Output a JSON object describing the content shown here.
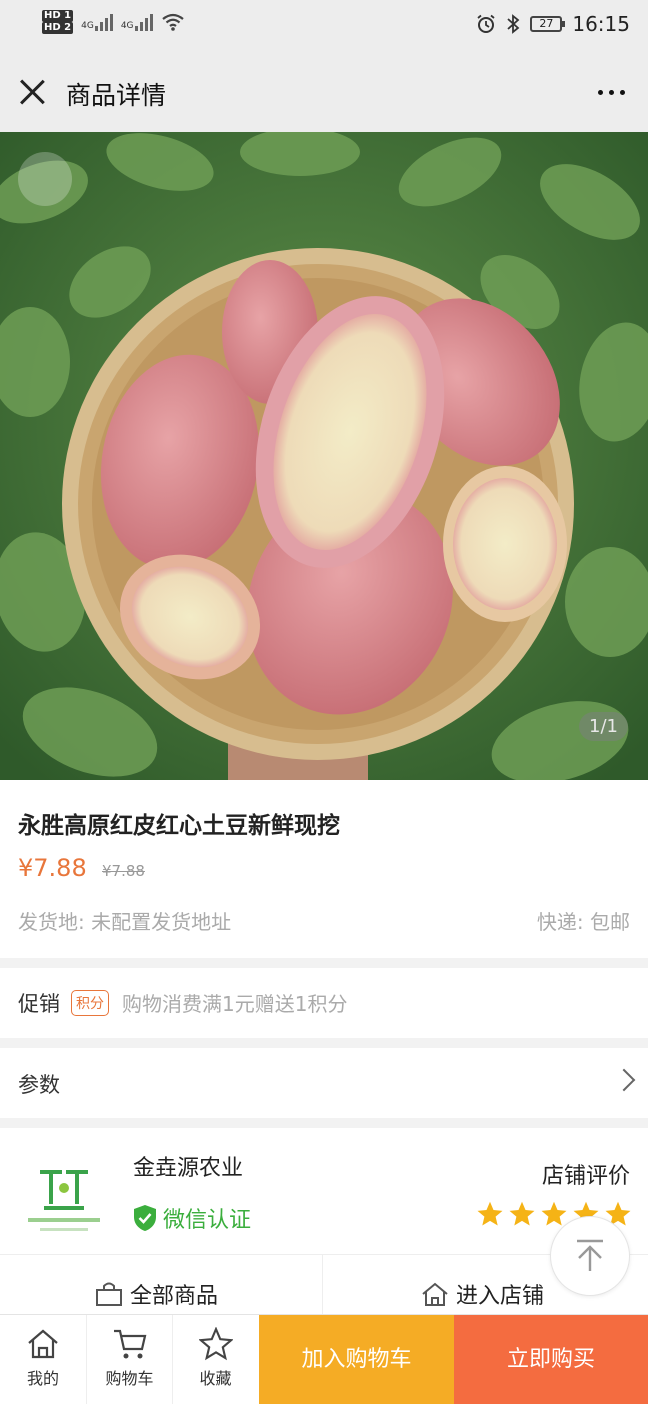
{
  "status_bar": {
    "net1": "HD 1",
    "net2": "HD 2",
    "sig1": "4G",
    "sig2": "4G",
    "battery": "27",
    "time": "16:15"
  },
  "nav": {
    "title": "商品详情"
  },
  "gallery": {
    "counter": "1/1"
  },
  "product": {
    "title": "永胜高原红皮红心土豆新鲜现挖",
    "price": "¥7.88",
    "original_price": "¥7.88",
    "ship_from": "发货地: 未配置发货地址",
    "express": "快递: 包邮"
  },
  "promotion": {
    "label": "促销",
    "tag": "积分",
    "text": "购物消费满1元赠送1积分"
  },
  "params": {
    "label": "参数"
  },
  "store": {
    "name": "金垚源农业",
    "verified": "微信认证",
    "rating_label": "店铺评价",
    "rating": 5,
    "all_products": "全部商品",
    "enter_store": "进入店铺"
  },
  "bottom_bar": {
    "mine": "我的",
    "cart": "购物车",
    "favorite": "收藏",
    "add_to_cart": "加入购物车",
    "buy_now": "立即购买"
  },
  "colors": {
    "accent_orange": "#e8763b",
    "cart_button": "#f5ac25",
    "buy_button": "#f46c40",
    "verified_green": "#3bae3d",
    "star_yellow": "#f5b316"
  }
}
